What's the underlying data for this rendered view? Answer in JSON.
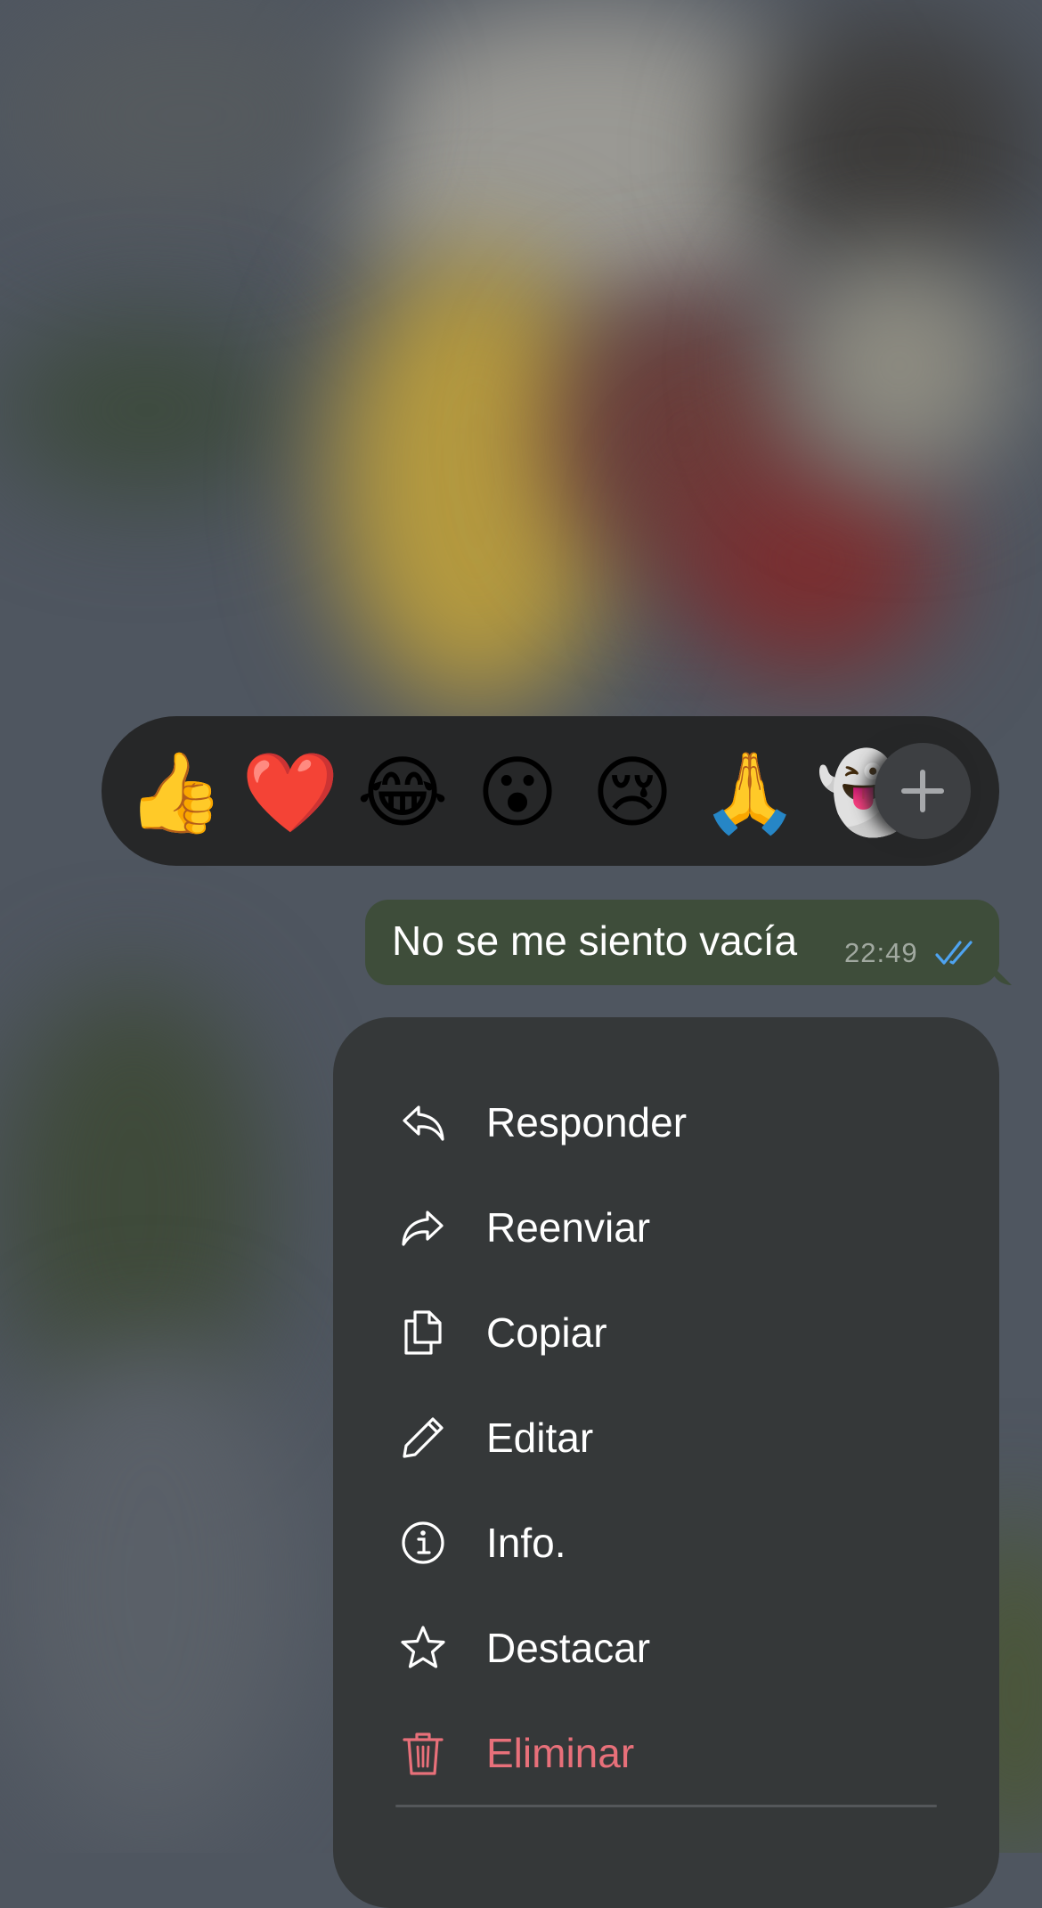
{
  "reactions": {
    "emojis": [
      {
        "char": "👍",
        "icon": "thumbs-up-emoji"
      },
      {
        "char": "❤️",
        "icon": "red-heart-emoji"
      },
      {
        "char": "😂",
        "icon": "face-with-tears-of-joy-emoji"
      },
      {
        "char": "😮",
        "icon": "surprised-face-emoji"
      },
      {
        "char": "😢",
        "icon": "crying-face-emoji"
      },
      {
        "char": "🙏",
        "icon": "folded-hands-emoji"
      },
      {
        "char": "👻",
        "icon": "ghost-emoji"
      }
    ],
    "more_icon": "plus-icon"
  },
  "message": {
    "text": "No se me siento vacía",
    "time": "22:49",
    "status_icon": "double-check-icon",
    "status_color": "#4ea3f0",
    "bubble_color": "#3e4d3a"
  },
  "menu": {
    "items": [
      {
        "label": "Responder",
        "icon": "reply-icon"
      },
      {
        "label": "Reenviar",
        "icon": "forward-icon"
      },
      {
        "label": "Copiar",
        "icon": "copy-icon"
      },
      {
        "label": "Editar",
        "icon": "pencil-icon"
      },
      {
        "label": "Info.",
        "icon": "info-icon"
      },
      {
        "label": "Destacar",
        "icon": "star-icon"
      },
      {
        "label": "Eliminar",
        "icon": "trash-icon"
      }
    ],
    "danger_color": "#e8707a"
  }
}
